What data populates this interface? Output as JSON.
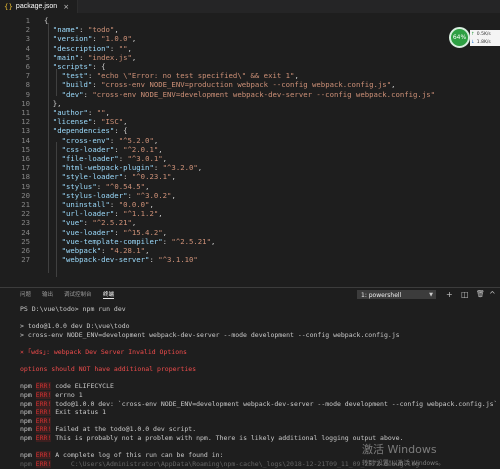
{
  "tab": {
    "icon": "{}",
    "name": "package.json",
    "close": "×"
  },
  "editor": {
    "lines": [
      {
        "n": "1",
        "text": "{"
      },
      {
        "n": "2",
        "text": "  \"name\": \"todo\","
      },
      {
        "n": "3",
        "text": "  \"version\": \"1.0.0\","
      },
      {
        "n": "4",
        "text": "  \"description\": \"\","
      },
      {
        "n": "5",
        "text": "  \"main\": \"index.js\","
      },
      {
        "n": "6",
        "text": "  \"scripts\": {"
      },
      {
        "n": "7",
        "text": "    \"test\": \"echo \\\"Error: no test specified\\\" && exit 1\","
      },
      {
        "n": "8",
        "text": "    \"build\": \"cross-env NODE_ENV=production webpack --config webpack.config.js\","
      },
      {
        "n": "9",
        "text": "    \"dev\": \"cross-env NODE_ENV=development webpack-dev-server --config webpack.config.js\""
      },
      {
        "n": "10",
        "text": "  },"
      },
      {
        "n": "11",
        "text": "  \"author\": \"\","
      },
      {
        "n": "12",
        "text": "  \"license\": \"ISC\","
      },
      {
        "n": "13",
        "text": "  \"dependencies\": {"
      },
      {
        "n": "14",
        "text": "    \"cross-env\": \"^5.2.0\","
      },
      {
        "n": "15",
        "text": "    \"css-loader\": \"^2.0.1\","
      },
      {
        "n": "16",
        "text": "    \"file-loader\": \"^3.0.1\","
      },
      {
        "n": "17",
        "text": "    \"html-webpack-plugin\": \"^3.2.0\","
      },
      {
        "n": "18",
        "text": "    \"style-loader\": \"^0.23.1\","
      },
      {
        "n": "19",
        "text": "    \"stylus\": \"^0.54.5\","
      },
      {
        "n": "20",
        "text": "    \"stylus-loader\": \"^3.0.2\","
      },
      {
        "n": "21",
        "text": "    \"uninstall\": \"0.0.0\","
      },
      {
        "n": "22",
        "text": "    \"url-loader\": \"^1.1.2\","
      },
      {
        "n": "23",
        "text": "    \"vue\": \"^2.5.21\","
      },
      {
        "n": "24",
        "text": "    \"vue-loader\": \"^15.4.2\","
      },
      {
        "n": "25",
        "text": "    \"vue-template-compiler\": \"^2.5.21\","
      },
      {
        "n": "26",
        "text": "    \"webpack\": \"4.28.1\","
      },
      {
        "n": "27",
        "text": "    \"webpack-dev-server\": \"^3.1.10\""
      }
    ]
  },
  "monitor": {
    "percent": "64%",
    "up": "0.5K/s",
    "down": "1.8K/s"
  },
  "panel": {
    "tabs": [
      "问题",
      "输出",
      "调试控制台",
      "终端"
    ],
    "select": "1: powershell",
    "icons": {
      "add": "+",
      "split": "◫",
      "trash": "🗑",
      "maximize": "^",
      "close": "×"
    }
  },
  "terminal": {
    "lines": [
      {
        "text": "PS D:\\vue\\todo> npm run dev",
        "cls": ""
      },
      {
        "text": "",
        "cls": ""
      },
      {
        "text": "> todo@1.0.0 dev D:\\vue\\todo",
        "cls": ""
      },
      {
        "text": "> cross-env NODE_ENV=development webpack-dev-server --mode development --config webpack.config.js",
        "cls": ""
      },
      {
        "text": "",
        "cls": ""
      },
      {
        "text": "× ｢wds｣: webpack Dev Server Invalid Options",
        "cls": "red"
      },
      {
        "text": "",
        "cls": ""
      },
      {
        "text": "options should NOT have additional properties",
        "cls": "red"
      },
      {
        "text": "",
        "cls": ""
      },
      {
        "text": "npm ERR! code ELIFECYCLE",
        "cls": ""
      },
      {
        "text": "npm ERR! errno 1",
        "cls": ""
      },
      {
        "text": "npm ERR! todo@1.0.0 dev: `cross-env NODE_ENV=development webpack-dev-server --mode development --config webpack.config.js`",
        "cls": ""
      },
      {
        "text": "npm ERR! Exit status 1",
        "cls": ""
      },
      {
        "text": "npm ERR!",
        "cls": ""
      },
      {
        "text": "npm ERR! Failed at the todo@1.0.0 dev script.",
        "cls": ""
      },
      {
        "text": "npm ERR! This is probably not a problem with npm. There is likely additional logging output above.",
        "cls": ""
      },
      {
        "text": "",
        "cls": ""
      },
      {
        "text": "npm ERR! A complete log of this run can be found in:",
        "cls": ""
      },
      {
        "text": "npm ERR!     C:\\Users\\Administrator\\AppData\\Roaming\\npm-cache\\_logs\\2018-12-21T09_11_09_257Z-debug.log",
        "cls": "grey"
      }
    ]
  },
  "watermark": {
    "line1": "激活 Windows",
    "line2": "转到\"设置\"以激活 Windows。"
  }
}
